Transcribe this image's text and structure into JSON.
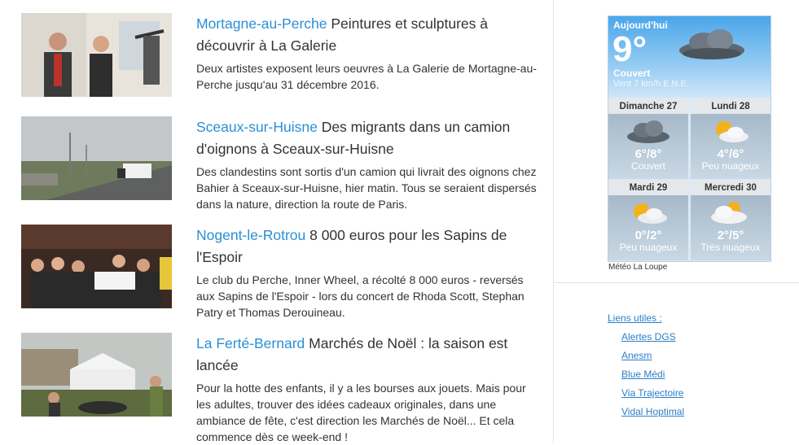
{
  "articles": [
    {
      "location": "Mortagne-au-Perche",
      "title": "Peintures et sculptures à découvrir à La Galerie",
      "description": "Deux artistes exposent leurs oeuvres à La Galerie de Mortagne-au-Perche jusqu'au 31 décembre 2016."
    },
    {
      "location": "Sceaux-sur-Huisne",
      "title": "Des migrants dans un camion d'oignons à Sceaux-sur-Huisne",
      "description": "Des clandestins sont sortis d'un camion qui livrait des oignons chez Bahier à Sceaux-sur-Huisne, hier matin. Tous se seraient dispersés dans la nature, direction la route de Paris."
    },
    {
      "location": "Nogent-le-Rotrou",
      "title": "8 000 euros pour les Sapins de l'Espoir",
      "description": "Le club du Perche, Inner Wheel, a récolté 8 000 euros - reversés aux Sapins de l'Espoir - lors du concert de Rhoda Scott, Stephan Patry et Thomas Derouineau."
    },
    {
      "location": "La Ferté-Bernard",
      "title": "Marchés de Noël : la saison est lancée",
      "description": "Pour la hotte des enfants, il y a les bourses aux jouets. Mais pour les adultes, trouver des idées cadeaux originales, dans une ambiance de fête, c'est direction les Marchés de Noël... Et cela commence dès ce week-end !"
    }
  ],
  "weather": {
    "today": {
      "label": "Aujourd'hui",
      "temp": "9°",
      "condition": "Couvert",
      "wind": "Vent 7 km/h E.N.E."
    },
    "days": [
      {
        "day": "Dimanche 27",
        "range": "6°/8°",
        "condition": "Couvert",
        "icon": "cloud-icon"
      },
      {
        "day": "Lundi 28",
        "range": "4°/6°",
        "condition": "Peu nuageux",
        "icon": "sun-cloud-icon"
      },
      {
        "day": "Mardi 29",
        "range": "0°/2°",
        "condition": "Peu nuageux",
        "icon": "sun-cloud-icon"
      },
      {
        "day": "Mercredi 30",
        "range": "2°/5°",
        "condition": "Très nuageux",
        "icon": "cloud-sun-icon"
      }
    ],
    "caption": "Météo La Loupe"
  },
  "links": {
    "title": "Liens utiles :",
    "items": [
      "Alertes DGS",
      "Anesm",
      "Blue Médi",
      "Via Trajectoire",
      "Vidal Hoptimal"
    ]
  },
  "colors": {
    "location": "#2a8fd6",
    "link": "#2a7fc6"
  }
}
